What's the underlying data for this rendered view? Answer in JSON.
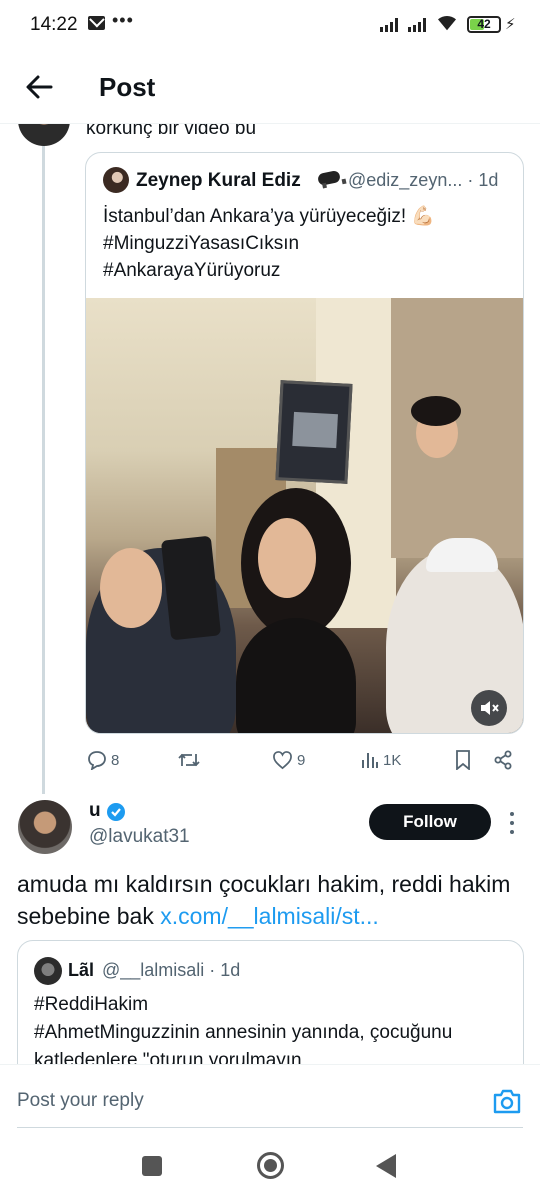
{
  "status_bar": {
    "time": "14:22",
    "battery": "42"
  },
  "header": {
    "title": "Post"
  },
  "parent_post": {
    "text": "korkunç bir video bu"
  },
  "quoted_post": {
    "name": "Zeynep Kural Ediz",
    "handle": "@ediz_zeyn...",
    "time": "· 1d",
    "text_line1": "İstanbul’dan Ankara’ya yürüyeceğiz! 💪🏻",
    "text_line2": "#MinguzziYasasıCıksın",
    "text_line3": "#AnkarayaYürüyoruz"
  },
  "actions": {
    "replies": "8",
    "likes": "9",
    "views": "1K"
  },
  "reply": {
    "name": "u",
    "handle": "@lavukat31",
    "follow_label": "Follow",
    "text": "amuda mı kaldırsın çocukları hakim, reddi hakim sebebine bak ",
    "link": "x.com/__lalmisali/st..."
  },
  "quoted_post_2": {
    "name": "Lãl",
    "handle": "@__lalmisali · 1d",
    "text": "#ReddiHakim\n #AhmetMinguzzinin annesinin yanında, çocuğunu katledenlere \"oturun yorulmayın"
  },
  "reply_bar": {
    "placeholder": "Post your reply"
  },
  "colors": {
    "accent": "#1d9bf0",
    "text": "#0f1419",
    "muted": "#536471",
    "border": "#cfd9de"
  }
}
